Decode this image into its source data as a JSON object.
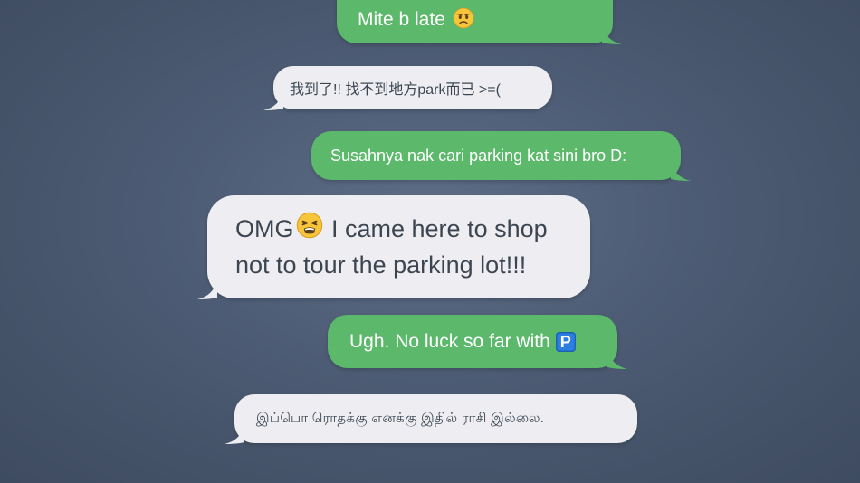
{
  "messages": [
    {
      "id": "m1",
      "side": "sent",
      "text": "Mite b late",
      "emoji": "worried-face"
    },
    {
      "id": "m2",
      "side": "received",
      "text": "我到了!! 找不到地方park而已 >=("
    },
    {
      "id": "m3",
      "side": "sent",
      "text": "Susahnya nak cari parking kat sini bro D:"
    },
    {
      "id": "m4",
      "side": "received",
      "text_line1": "OMG",
      "text_line1_rest": " I came here to shop",
      "text_line2": "not to tour the parking lot!!!",
      "emoji": "tired-face"
    },
    {
      "id": "m5",
      "side": "sent",
      "text": "Ugh. No luck so far with",
      "emoji": "parking-sign",
      "emoji_glyph": "P"
    },
    {
      "id": "m6",
      "side": "received",
      "text": "இப்பொ ரொதக்கு எனக்கு இதில் ராசி இல்லை."
    }
  ],
  "colors": {
    "sent_bubble": "#5cb96b",
    "received_bubble": "#eeeef2",
    "background": "#4c5b73"
  }
}
